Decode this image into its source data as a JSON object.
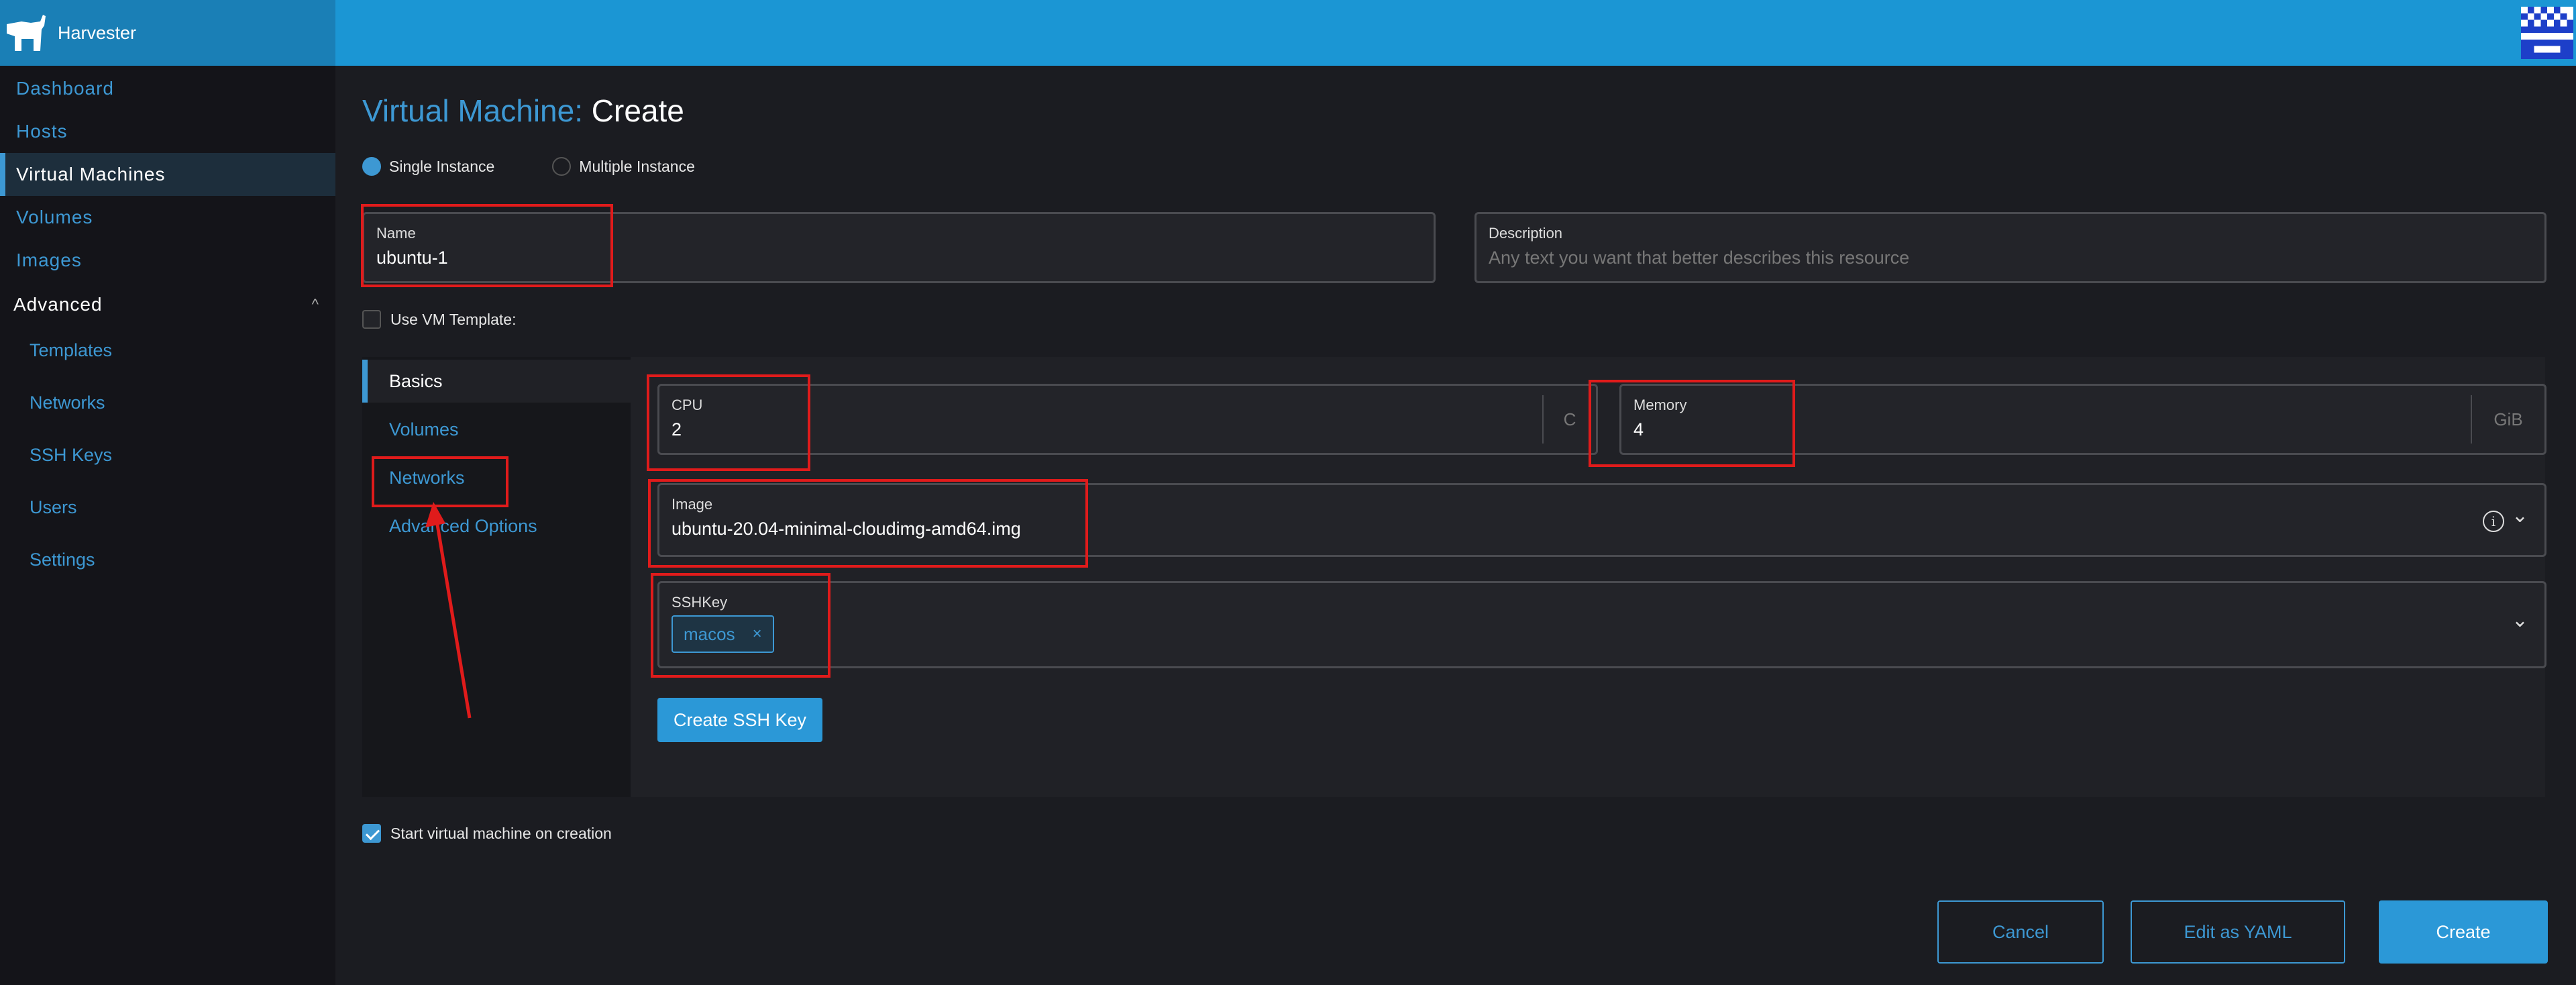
{
  "app": {
    "name": "Harvester"
  },
  "sidebar": {
    "items": [
      {
        "label": "Dashboard"
      },
      {
        "label": "Hosts"
      },
      {
        "label": "Virtual Machines"
      },
      {
        "label": "Volumes"
      },
      {
        "label": "Images"
      }
    ],
    "group": {
      "label": "Advanced",
      "chevron": "^"
    },
    "sub_items": [
      {
        "label": "Templates"
      },
      {
        "label": "Networks"
      },
      {
        "label": "SSH Keys"
      },
      {
        "label": "Users"
      },
      {
        "label": "Settings"
      }
    ]
  },
  "page": {
    "title_prefix": "Virtual Machine:",
    "title_action": "Create"
  },
  "instance_mode": {
    "options": [
      {
        "label": "Single Instance",
        "selected": true
      },
      {
        "label": "Multiple Instance",
        "selected": false
      }
    ]
  },
  "name_field": {
    "label": "Name",
    "value": "ubuntu-1"
  },
  "description_field": {
    "label": "Description",
    "placeholder": "Any text you want that better describes this resource"
  },
  "vm_template": {
    "label": "Use VM Template:",
    "checked": false
  },
  "tabs": [
    {
      "label": "Basics",
      "active": true
    },
    {
      "label": "Volumes",
      "active": false
    },
    {
      "label": "Networks",
      "active": false
    },
    {
      "label": "Advanced Options",
      "active": false
    }
  ],
  "cpu_field": {
    "label": "CPU",
    "value": "2",
    "suffix": "C"
  },
  "memory_field": {
    "label": "Memory",
    "value": "4",
    "suffix": "GiB"
  },
  "image_field": {
    "label": "Image",
    "value": "ubuntu-20.04-minimal-cloudimg-amd64.img",
    "info_icon": "i",
    "chevron": "⌄"
  },
  "sshkey_field": {
    "label": "SSHKey",
    "tags": [
      {
        "label": "macos",
        "remove": "×"
      }
    ],
    "chevron": "⌄"
  },
  "create_ssh_key_button": {
    "label": "Create SSH Key"
  },
  "start_on_creation": {
    "label": "Start virtual machine on creation",
    "checked": true
  },
  "footer": {
    "cancel_label": "Cancel",
    "yaml_label": "Edit as YAML",
    "create_label": "Create"
  },
  "colors": {
    "accent": "#3d98d3",
    "topbar": "#1b96d4",
    "highlight": "#e01b1b"
  }
}
